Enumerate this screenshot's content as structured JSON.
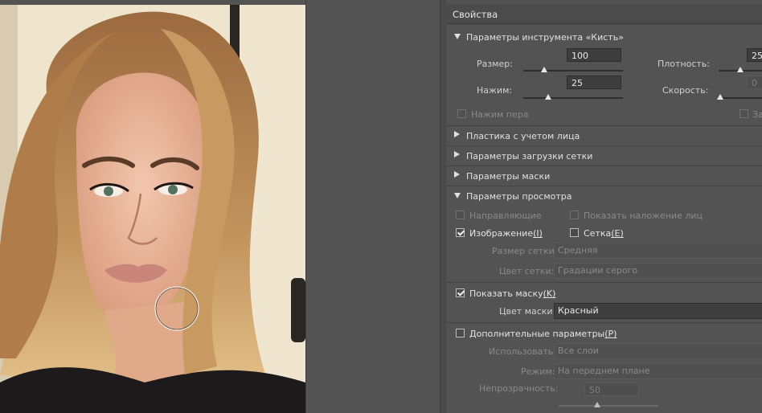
{
  "panel": {
    "title": "Свойства"
  },
  "brush": {
    "section_title": "Параметры инструмента «Кисть»",
    "size_label": "Размер:",
    "size_value": "100",
    "size_level_percent": 10,
    "density_label": "Плотность:",
    "density_value": "25",
    "pressure_label": "Нажим:",
    "pressure_value": "25",
    "speed_label": "Скорость:",
    "speed_value": "0",
    "pen_pressure_label": "Нажим пера",
    "pin_label": "За"
  },
  "sections": {
    "face_liquify": "Пластика с учетом лица",
    "mesh_load": "Параметры загрузки сетки",
    "mask": "Параметры маски",
    "view": "Параметры просмотра"
  },
  "view": {
    "guides_label": "Направляющие",
    "face_overlay_label": "Показать наложение лиц",
    "image_label": "Изображение",
    "image_hotkey": "(I)",
    "mesh_label": "Сетка",
    "mesh_hotkey": "(E)",
    "mesh_size_label": "Размер сетки:",
    "mesh_size_value": "Средняя",
    "mesh_color_label": "Цвет сетки:",
    "mesh_color_value": "Градации серого",
    "show_mask_label": "Показать маску",
    "show_mask_hotkey": "(K)",
    "mask_color_label": "Цвет маски:",
    "mask_color_value": "Красный",
    "extra_label": "Дополнительные параметры",
    "extra_hotkey": "(P)",
    "use_label": "Использовать:",
    "use_value": "Все слои",
    "mode_label": "Режим:",
    "mode_value": "На переднем плане",
    "opacity_label": "Непрозрачность:",
    "opacity_value": "50"
  },
  "colors": {
    "panel_bg": "#535353",
    "field_bg": "#3d3d3d",
    "text": "#dcdcdc"
  }
}
